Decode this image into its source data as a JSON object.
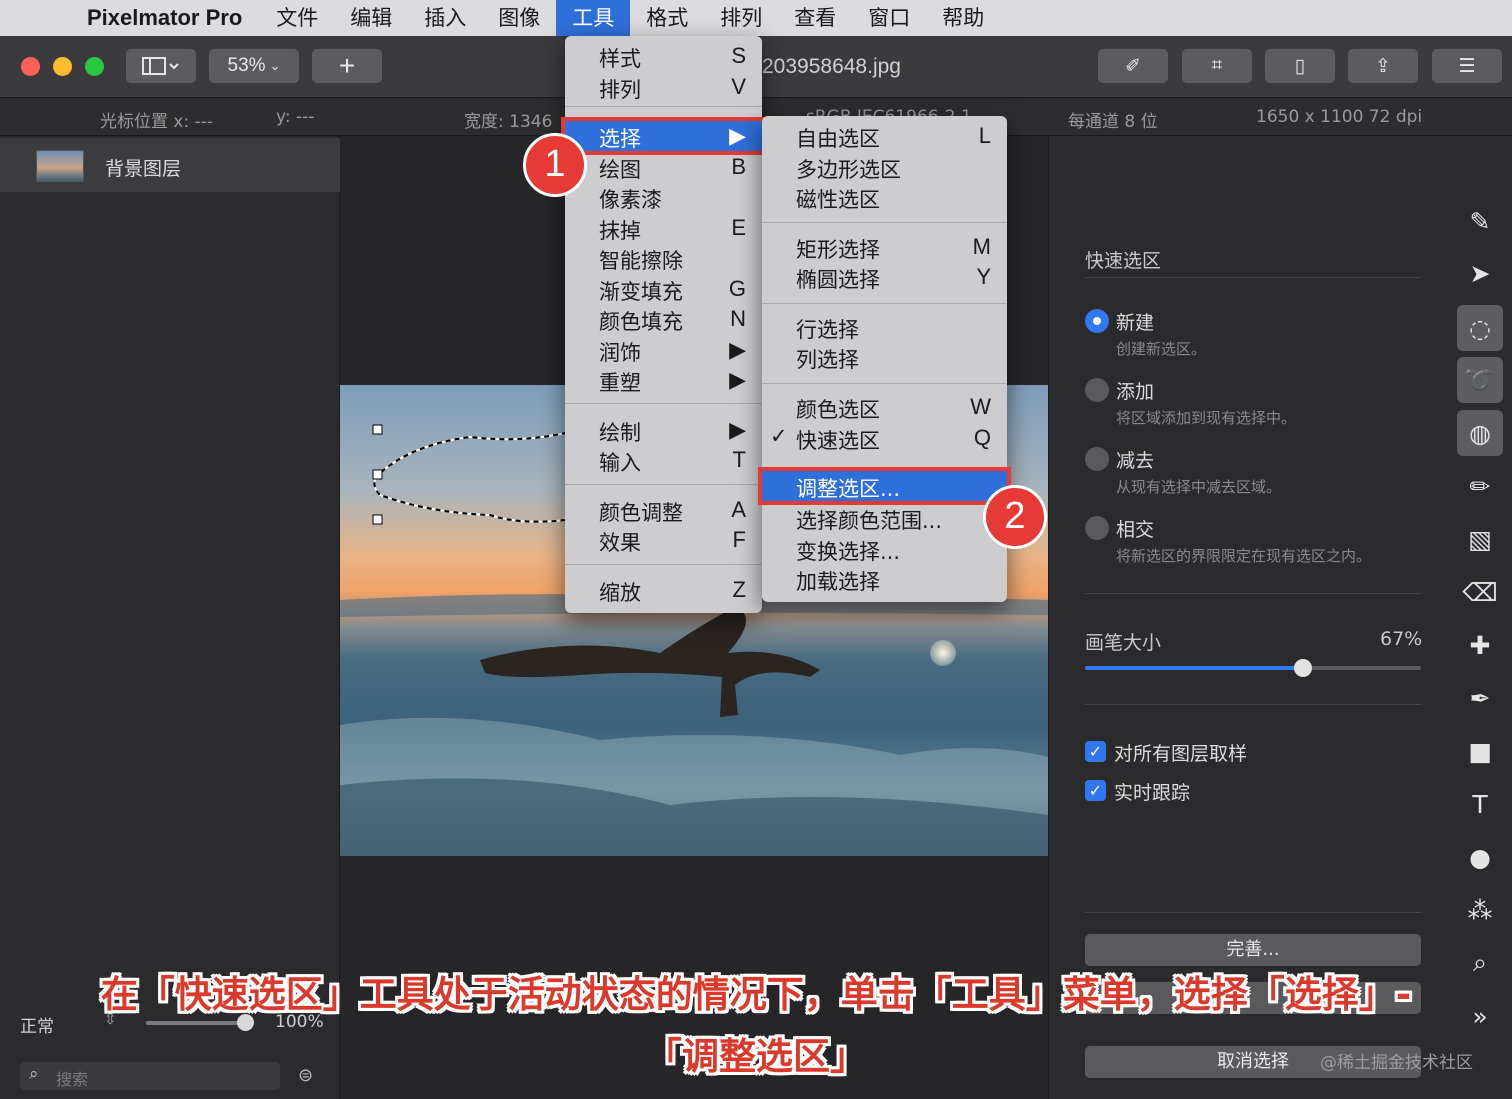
{
  "menubar": {
    "app_name": "Pixelmator Pro",
    "items": [
      "文件",
      "编辑",
      "插入",
      "图像",
      "工具",
      "格式",
      "排列",
      "查看",
      "窗口",
      "帮助"
    ]
  },
  "toolbar": {
    "zoom": "53%",
    "add": "+",
    "doc_title": "203958648.jpg"
  },
  "infobar": {
    "cursor_x": "光标位置 x:  ---",
    "cursor_y": "y:  ---",
    "width": "宽度: 1346",
    "color_profile": "sRGB IEC61966-2.1",
    "bits": "每通道 8 位",
    "size": "1650 x 1100 72 dpi"
  },
  "layers": {
    "name": "背景图层",
    "blend_mode": "正常",
    "opacity": "100%",
    "search_placeholder": "搜索"
  },
  "tools_menu": {
    "items": [
      {
        "label": "样式",
        "key": "S"
      },
      {
        "label": "排列",
        "key": "V"
      },
      {
        "label": "选择",
        "key": "▶"
      },
      {
        "label": "绘图",
        "key": "B"
      },
      {
        "label": "像素漆",
        "key": ""
      },
      {
        "label": "抹掉",
        "key": "E"
      },
      {
        "label": "智能擦除",
        "key": ""
      },
      {
        "label": "渐变填充",
        "key": "G"
      },
      {
        "label": "颜色填充",
        "key": "N"
      },
      {
        "label": "润饰",
        "key": "▶"
      },
      {
        "label": "重塑",
        "key": "▶"
      },
      {
        "label": "绘制",
        "key": "▶"
      },
      {
        "label": "输入",
        "key": "T"
      },
      {
        "label": "颜色调整",
        "key": "A"
      },
      {
        "label": "效果",
        "key": "F"
      },
      {
        "label": "缩放",
        "key": "Z"
      }
    ]
  },
  "select_submenu": {
    "items": [
      {
        "label": "自由选区",
        "key": "L"
      },
      {
        "label": "多边形选区",
        "key": ""
      },
      {
        "label": "磁性选区",
        "key": ""
      },
      {
        "label": "矩形选择",
        "key": "M"
      },
      {
        "label": "椭圆选择",
        "key": "Y"
      },
      {
        "label": "行选择",
        "key": ""
      },
      {
        "label": "列选择",
        "key": ""
      },
      {
        "label": "颜色选区",
        "key": "W"
      },
      {
        "label": "快速选区",
        "key": "Q",
        "checked": "✓"
      },
      {
        "label": "调整选区...",
        "key": ""
      },
      {
        "label": "选择颜色范围...",
        "key": ""
      },
      {
        "label": "变换选择...",
        "key": ""
      },
      {
        "label": "加载选择",
        "key": ""
      }
    ]
  },
  "badges": [
    "1",
    "2"
  ],
  "right_panel": {
    "title": "快速选区",
    "options": [
      {
        "label": "新建",
        "desc": "创建新选区。"
      },
      {
        "label": "添加",
        "desc": "将区域添加到现有选择中。"
      },
      {
        "label": "减去",
        "desc": "从现有选择中减去区域。"
      },
      {
        "label": "相交",
        "desc": "将新选区的界限限定在现有选区之内。"
      }
    ],
    "brush_label": "画笔大小",
    "brush_value": "67%",
    "brush_level": 0.65,
    "sample_all": "对所有图层取样",
    "live_track": "实时跟踪",
    "refine": "完善...",
    "deselect": "取消选择"
  },
  "caption_line1": "在「快速选区」工具处于活动状态的情况下，单击「工具」菜单，选择「选择」-",
  "caption_line2": "「调整选区」",
  "watermark": "@稀土掘金技术社区",
  "colors": {
    "accent": "#2f6fd9",
    "annotation": "#e53935"
  }
}
